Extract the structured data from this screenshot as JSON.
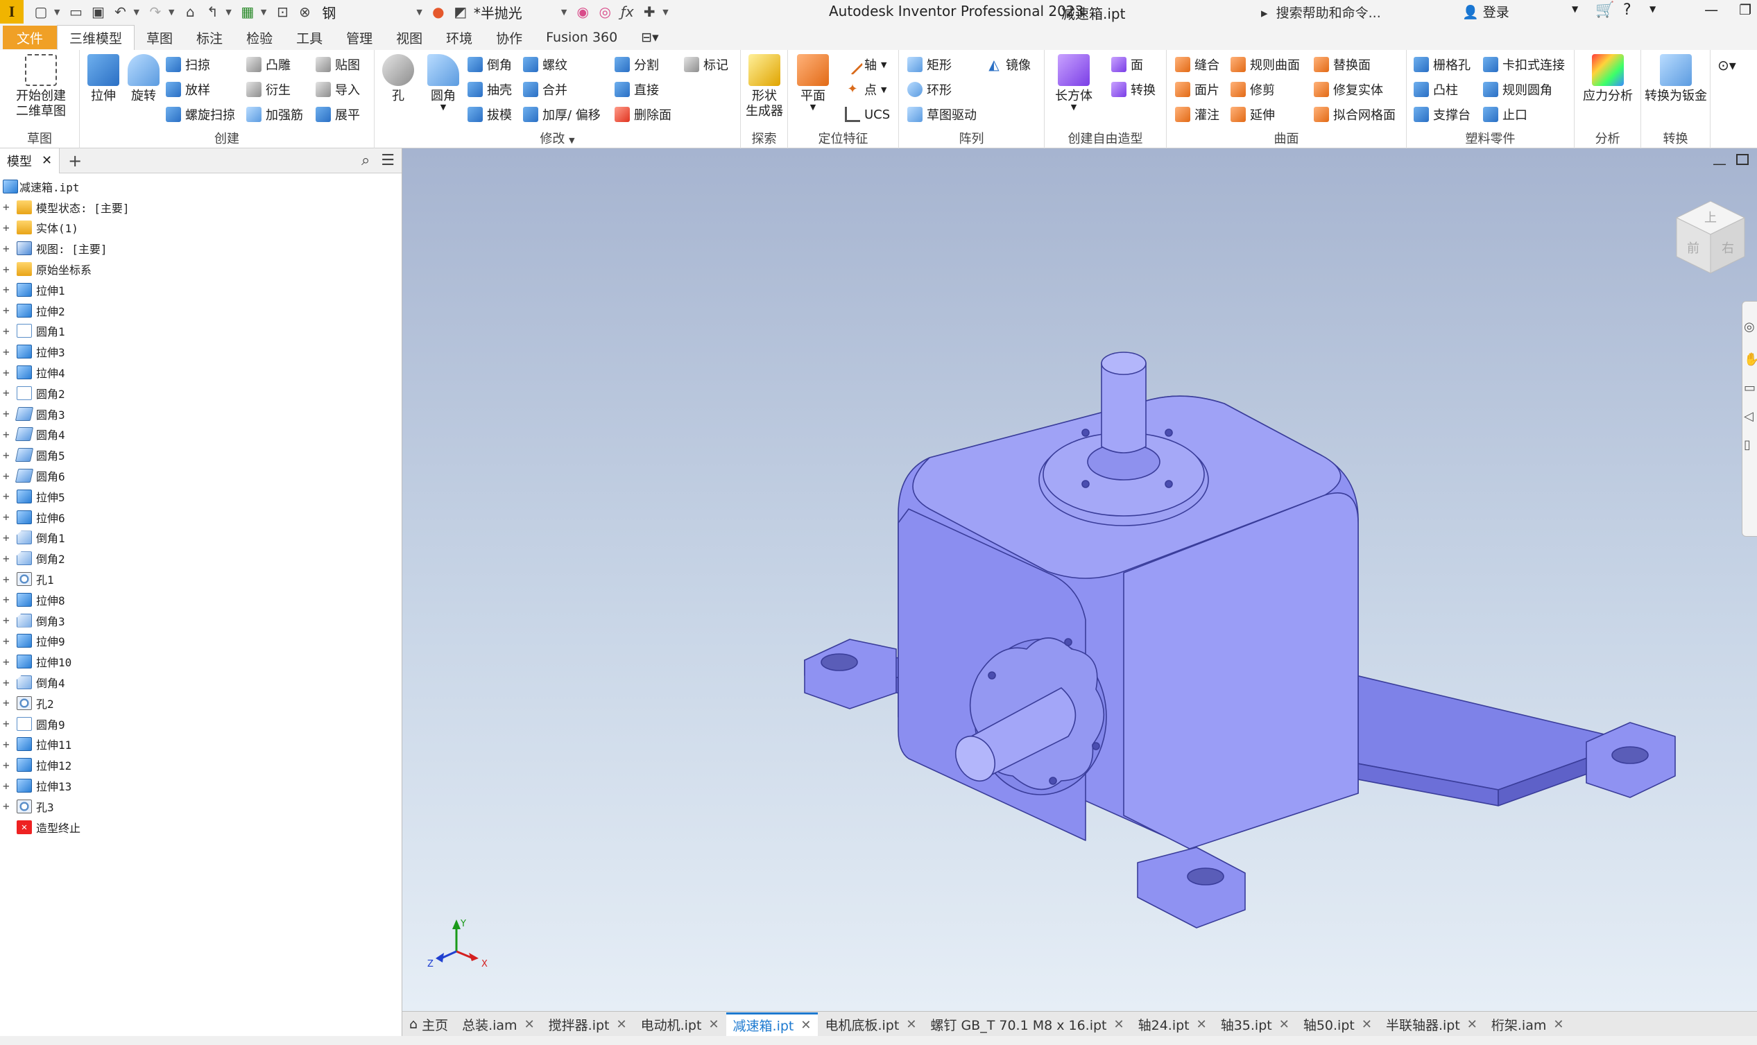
{
  "app": {
    "title": "Autodesk Inventor Professional 2023",
    "file": "减速箱.ipt",
    "logo": "I"
  },
  "quickaccess": {
    "material": "钢",
    "appearance": "*半抛光"
  },
  "help_search": "搜索帮助和命令...",
  "user": {
    "login": "登录"
  },
  "menu_tabs": [
    "文件",
    "三维模型",
    "草图",
    "标注",
    "检验",
    "工具",
    "管理",
    "视图",
    "环境",
    "协作",
    "Fusion 360"
  ],
  "ribbon": {
    "sketch": {
      "label": "草图",
      "start_sketch": "开始创建\n二维草图"
    },
    "create": {
      "label": "创建",
      "extrude": "拉伸",
      "revolve": "旋转",
      "sweep": "扫掠",
      "loft": "放样",
      "coil": "螺旋扫掠",
      "emboss": "凸雕",
      "derive": "衍生",
      "rib": "加强筋",
      "decal": "贴图",
      "import": "导入",
      "unfold": "展平"
    },
    "modify": {
      "label": "修改",
      "hole": "孔",
      "fillet": "圆角",
      "chamfer": "倒角",
      "shell": "抽壳",
      "draft": "拔模",
      "thread": "螺纹",
      "combine": "合并",
      "thicken": "加厚/ 偏移",
      "split": "分割",
      "direct": "直接",
      "delete_face": "删除面",
      "mark": "标记"
    },
    "explore": {
      "label": "探索",
      "shape_gen": "形状\n生成器"
    },
    "work": {
      "label": "定位特征",
      "plane": "平面",
      "axis": "轴",
      "point": "点",
      "ucs": "UCS"
    },
    "pattern": {
      "label": "阵列",
      "rect": "矩形",
      "circ": "环形",
      "sketch_driven": "草图驱动",
      "mirror": "镜像"
    },
    "freeform": {
      "label": "创建自由造型",
      "box": "长方体",
      "face": "面",
      "convert": "转换"
    },
    "surface": {
      "label": "曲面",
      "stitch": "缝合",
      "patch": "面片",
      "sculpt": "灌注",
      "ruled": "规则曲面",
      "trim": "修剪",
      "extend": "延伸",
      "replace": "替换面",
      "repair": "修复实体",
      "mesh": "拟合网格面"
    },
    "plastic": {
      "label": "塑料零件",
      "grill": "栅格孔",
      "boss": "凸柱",
      "rest": "支撑台",
      "snap": "卡扣式连接",
      "rule_fillet": "规则圆角",
      "lip": "止口"
    },
    "analysis": {
      "label": "分析",
      "stress": "应力分析"
    },
    "convert": {
      "label": "转换",
      "sheetmetal": "转换为钣金"
    }
  },
  "browser": {
    "tab": "模型",
    "root": "减速箱.ipt",
    "nodes": [
      {
        "label": "模型状态: [主要]",
        "icon": "folder"
      },
      {
        "label": "实体(1)",
        "icon": "folder"
      },
      {
        "label": "视图: [主要]",
        "icon": "view"
      },
      {
        "label": "原始坐标系",
        "icon": "folder"
      },
      {
        "label": "拉伸1",
        "icon": "solid"
      },
      {
        "label": "拉伸2",
        "icon": "solid"
      },
      {
        "label": "圆角1",
        "icon": "fillet"
      },
      {
        "label": "拉伸3",
        "icon": "solid"
      },
      {
        "label": "拉伸4",
        "icon": "solid"
      },
      {
        "label": "圆角2",
        "icon": "fillet"
      },
      {
        "label": "圆角3",
        "icon": "face"
      },
      {
        "label": "圆角4",
        "icon": "face"
      },
      {
        "label": "圆角5",
        "icon": "face"
      },
      {
        "label": "圆角6",
        "icon": "face"
      },
      {
        "label": "拉伸5",
        "icon": "solid"
      },
      {
        "label": "拉伸6",
        "icon": "solid"
      },
      {
        "label": "倒角1",
        "icon": "chamfer"
      },
      {
        "label": "倒角2",
        "icon": "chamfer"
      },
      {
        "label": "孔1",
        "icon": "hole"
      },
      {
        "label": "拉伸8",
        "icon": "solid"
      },
      {
        "label": "倒角3",
        "icon": "chamfer"
      },
      {
        "label": "拉伸9",
        "icon": "solid"
      },
      {
        "label": "拉伸10",
        "icon": "solid"
      },
      {
        "label": "倒角4",
        "icon": "chamfer"
      },
      {
        "label": "孔2",
        "icon": "hole"
      },
      {
        "label": "圆角9",
        "icon": "fillet"
      },
      {
        "label": "拉伸11",
        "icon": "solid"
      },
      {
        "label": "拉伸12",
        "icon": "solid"
      },
      {
        "label": "拉伸13",
        "icon": "solid"
      },
      {
        "label": "孔3",
        "icon": "hole"
      },
      {
        "label": "造型终止",
        "icon": "end"
      }
    ]
  },
  "viewcube": {
    "top": "上",
    "front": "前",
    "right": "右"
  },
  "triad": {
    "x": "X",
    "y": "Y",
    "z": "Z"
  },
  "doc_tabs": [
    {
      "label": "主页",
      "closable": false
    },
    {
      "label": "总装.iam",
      "closable": true
    },
    {
      "label": "搅拌器.ipt",
      "closable": true
    },
    {
      "label": "电动机.ipt",
      "closable": true
    },
    {
      "label": "减速箱.ipt",
      "closable": true,
      "active": true
    },
    {
      "label": "电机底板.ipt",
      "closable": true
    },
    {
      "label": "螺钉 GB_T 70.1 M8 x 16.ipt",
      "closable": true
    },
    {
      "label": "轴24.ipt",
      "closable": true
    },
    {
      "label": "轴35.ipt",
      "closable": true
    },
    {
      "label": "轴50.ipt",
      "closable": true
    },
    {
      "label": "半联轴器.ipt",
      "closable": true
    },
    {
      "label": "桁架.iam",
      "closable": true
    }
  ],
  "colors": {
    "model": "#8f92f2",
    "file_tab": "#f0a026",
    "active_tab": "#1e7ad0"
  }
}
